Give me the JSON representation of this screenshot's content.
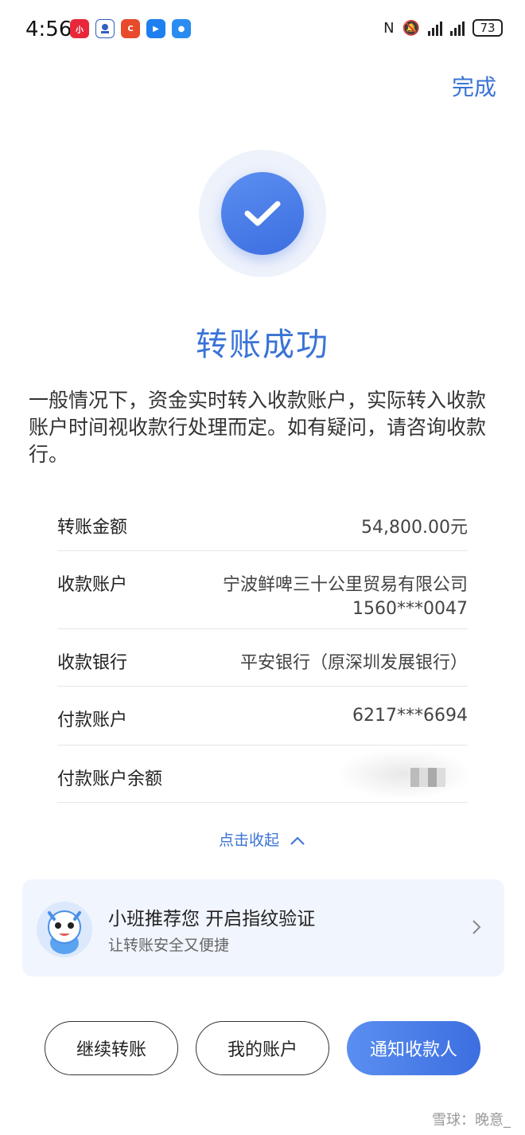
{
  "status_bar": {
    "time": "4:56",
    "battery": "73"
  },
  "header": {
    "done_label": "完成"
  },
  "result": {
    "title": "转账成功",
    "notice": "一般情况下，资金实时转入收款账户，实际转入收款账户时间视收款行处理而定。如有疑问，请咨询收款行。"
  },
  "details": {
    "amount_label": "转账金额",
    "amount_value": "54,800.00元",
    "payee_label": "收款账户",
    "payee_name": "宁波鲜啤三十公里贸易有限公司",
    "payee_account": "1560***0047",
    "bank_label": "收款银行",
    "bank_value": "平安银行（原深圳发展银行）",
    "payer_label": "付款账户",
    "payer_value": "6217***6694",
    "balance_label": "付款账户余额"
  },
  "collapse_label": "点击收起",
  "promo": {
    "title": "小班推荐您 开启指纹验证",
    "subtitle": "让转账安全又便捷"
  },
  "actions": {
    "continue_label": "继续转账",
    "my_account_label": "我的账户",
    "notify_label": "通知收款人"
  },
  "watermark": "雪球：晚意_",
  "colors": {
    "accent": "#3a73d6",
    "primary_button": "#4a7fe8"
  }
}
